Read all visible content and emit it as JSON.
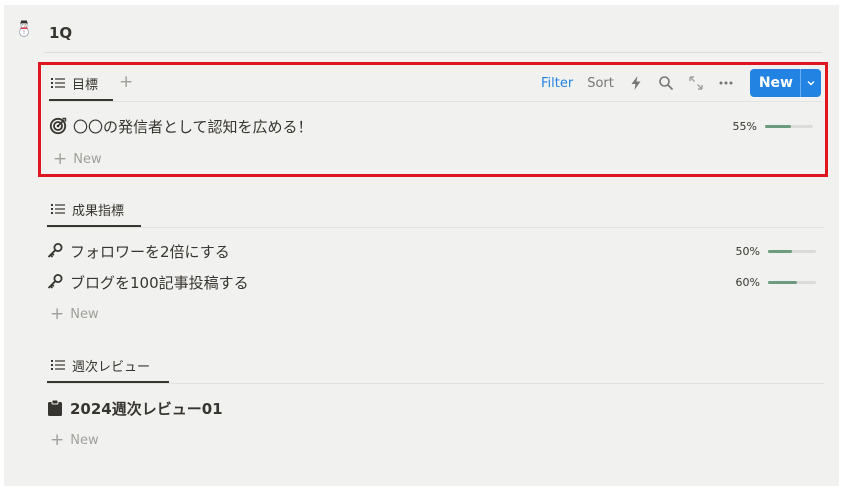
{
  "page": {
    "title": "1Q",
    "icon": "snowman-icon"
  },
  "sections": [
    {
      "tab_label": "目標",
      "toolbar": {
        "filter": "Filter",
        "sort": "Sort",
        "new_label": "New"
      },
      "rows": [
        {
          "icon": "target-icon",
          "name": "〇〇の発信者として認知を広める！",
          "percent": "55%",
          "progress": 0.55
        }
      ],
      "new_label": "New"
    },
    {
      "tab_label": "成果指標",
      "rows": [
        {
          "icon": "key-icon",
          "name": "フォロワーを2倍にする",
          "percent": "50%",
          "progress": 0.5
        },
        {
          "icon": "key-icon",
          "name": "ブログを100記事投稿する",
          "percent": "60%",
          "progress": 0.6
        }
      ],
      "new_label": "New"
    },
    {
      "tab_label": "週次レビュー",
      "rows": [
        {
          "icon": "clipboard-icon",
          "name": "2024週次レビュー01"
        }
      ],
      "new_label": "New"
    }
  ],
  "colors": {
    "background": "#f1f1ef",
    "accent": "#2383e2",
    "progress": "#6c9b7d",
    "highlight_border": "#e0161e"
  }
}
